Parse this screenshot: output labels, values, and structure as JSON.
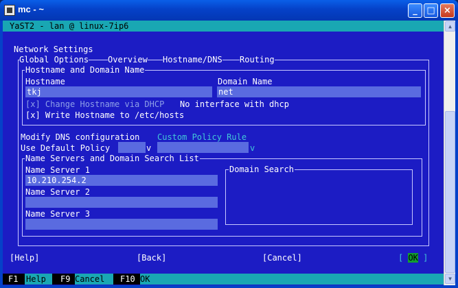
{
  "window": {
    "title": "mc - ~"
  },
  "window_buttons": {
    "minimize": "_",
    "maximize": "□",
    "close": "×"
  },
  "yast_header": "YaST2 - lan @ linux-7ip6",
  "dialog": {
    "title": "Network Settings",
    "tabs": [
      "Global Options",
      "Overview",
      "Hostname/DNS",
      "Routing"
    ],
    "hostname_frame": {
      "label": "Hostname and Domain Name",
      "hostname_label": "Hostname",
      "hostname_value": "tkj",
      "domain_label": "Domain Name",
      "domain_value": "net",
      "dhcp_checkbox": "[x] Change Hostname via DHCP",
      "dhcp_note": "No interface with dhcp",
      "hosts_checkbox": "[x] Write Hostname to /etc/hosts"
    },
    "dns": {
      "modify_label": "Modify DNS configuration",
      "custom_rule_label": "Custom Policy Rule",
      "default_policy_label": "Use Default Policy",
      "dropdown_arrow": "v"
    },
    "ns_frame": {
      "label": "Name Servers and Domain Search List",
      "ns1_label": "Name Server 1",
      "ns1_value": "10.210.254.2",
      "ns2_label": "Name Server 2",
      "ns2_value": "",
      "ns3_label": "Name Server 3",
      "ns3_value": "",
      "domain_search_label": "Domain Search"
    },
    "buttons": {
      "help": "[Help]",
      "back": "[Back]",
      "cancel": "[Cancel]",
      "ok_left": "[ ",
      "ok_label": "OK",
      "ok_right": " ]"
    }
  },
  "function_bar": [
    {
      "key": "F1",
      "label": "Help"
    },
    {
      "key": "F9",
      "label": "Cancel"
    },
    {
      "key": "F10",
      "label": "OK"
    }
  ]
}
